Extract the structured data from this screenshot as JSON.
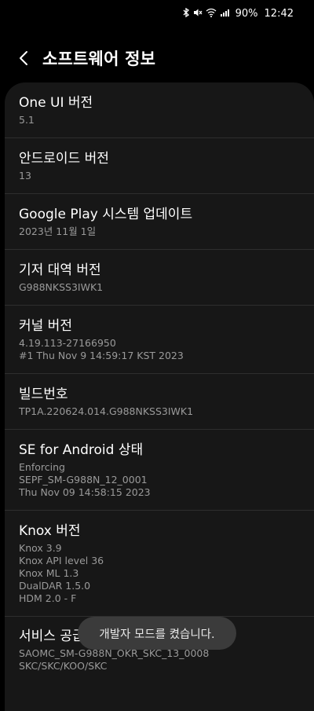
{
  "status_bar": {
    "icons": [
      "bluetooth-icon",
      "mute-icon",
      "wifi-icon",
      "signal-icon"
    ],
    "battery": "90%",
    "time": "12:42"
  },
  "header": {
    "title": "소프트웨어 정보"
  },
  "items": [
    {
      "title": "One UI 버전",
      "lines": [
        "5.1"
      ]
    },
    {
      "title": "안드로이드 버전",
      "lines": [
        "13"
      ]
    },
    {
      "title": "Google Play 시스템 업데이트",
      "lines": [
        "2023년 11월 1일"
      ]
    },
    {
      "title": "기저 대역 버전",
      "lines": [
        "G988NKSS3IWK1"
      ]
    },
    {
      "title": "커널 버전",
      "lines": [
        "4.19.113-27166950",
        "#1 Thu Nov 9 14:59:17 KST 2023"
      ]
    },
    {
      "title": "빌드번호",
      "lines": [
        "TP1A.220624.014.G988NKSS3IWK1"
      ]
    },
    {
      "title": "SE for Android 상태",
      "lines": [
        "Enforcing",
        "SEPF_SM-G988N_12_0001",
        "Thu Nov 09 14:58:15 2023"
      ]
    },
    {
      "title": "Knox 버전",
      "lines": [
        "Knox 3.9",
        "Knox API level 36",
        "Knox ML 1.3",
        "DualDAR 1.5.0",
        "HDM 2.0 - F"
      ]
    },
    {
      "title": "서비스 공급자 소프트웨어 버전",
      "lines": [
        "SAOMC_SM-G988N_OKR_SKC_13_0008",
        "SKC/SKC/KOO/SKC"
      ]
    }
  ],
  "toast": {
    "text": "개발자 모드를 켰습니다."
  }
}
